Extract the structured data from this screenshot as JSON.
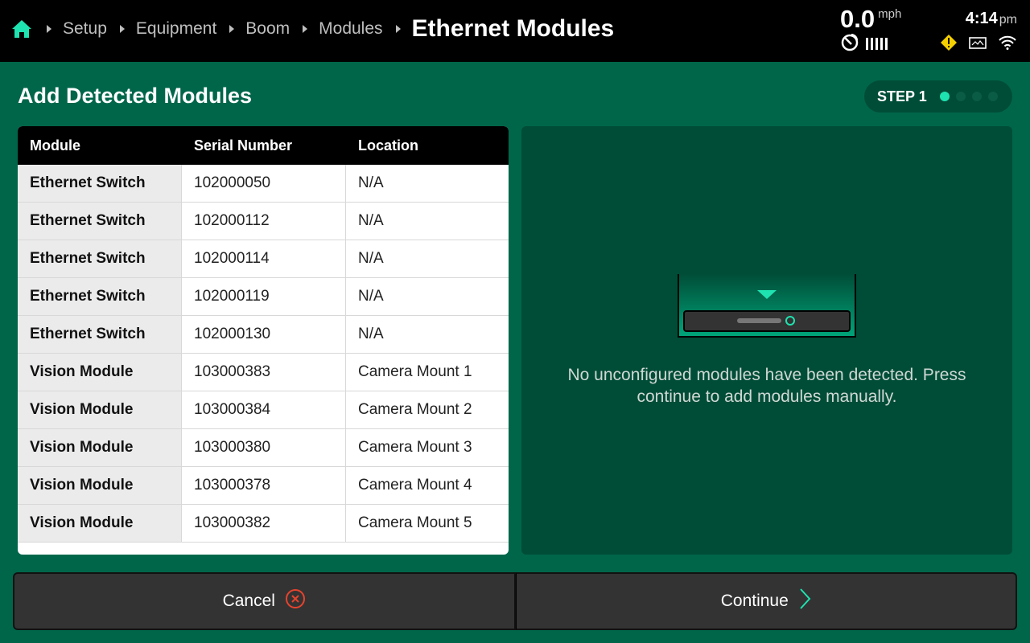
{
  "topbar": {
    "breadcrumbs": [
      "Setup",
      "Equipment",
      "Boom",
      "Modules"
    ],
    "current": "Ethernet Modules",
    "speed": {
      "value": "0.0",
      "unit": "mph"
    },
    "time": {
      "value": "4:14",
      "ampm": "pm"
    },
    "icons": [
      "home-icon",
      "gps-icon",
      "signal-bars-icon",
      "warning-icon",
      "display-icon",
      "wifi-icon"
    ],
    "warning_color": "#f5d000",
    "home_color": "#1ee3b0"
  },
  "page": {
    "title": "Add Detected Modules",
    "step_label": "STEP 1",
    "steps_total": 4,
    "step_current": 1
  },
  "table": {
    "headers": [
      "Module",
      "Serial Number",
      "Location"
    ],
    "rows": [
      [
        "Ethernet Switch",
        "102000050",
        "N/A"
      ],
      [
        "Ethernet Switch",
        "102000112",
        "N/A"
      ],
      [
        "Ethernet Switch",
        "102000114",
        "N/A"
      ],
      [
        "Ethernet Switch",
        "102000119",
        "N/A"
      ],
      [
        "Ethernet Switch",
        "102000130",
        "N/A"
      ],
      [
        "Vision Module",
        "103000383",
        "Camera Mount 1"
      ],
      [
        "Vision Module",
        "103000384",
        "Camera Mount 2"
      ],
      [
        "Vision Module",
        "103000380",
        "Camera Mount 3"
      ],
      [
        "Vision Module",
        "103000378",
        "Camera Mount 4"
      ],
      [
        "Vision Module",
        "103000382",
        "Camera Mount 5"
      ]
    ]
  },
  "info": {
    "message": "No unconfigured modules have been detected. Press continue to add modules manually."
  },
  "buttons": {
    "cancel": "Cancel",
    "continue": "Continue"
  },
  "colors": {
    "background": "#00664a",
    "panel": "#004d37",
    "accent": "#1ee3b0",
    "cancel_icon": "#e8432d"
  }
}
